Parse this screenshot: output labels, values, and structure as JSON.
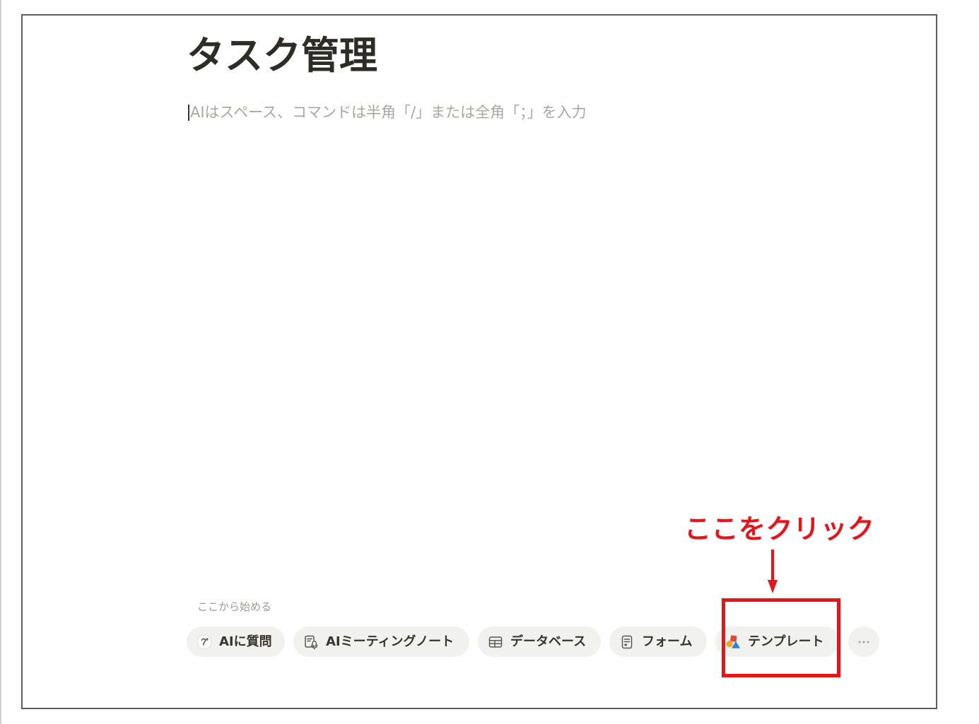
{
  "page": {
    "title": "タスク管理",
    "placeholder": "AIはスペース、コマンドは半角「/」または全角「；」を入力"
  },
  "start_section": {
    "label": "ここから始める",
    "buttons": [
      {
        "label": "AIに質問",
        "icon": "ai-face-icon"
      },
      {
        "label": "AIミーティングノート",
        "icon": "meeting-notes-icon"
      },
      {
        "label": "データベース",
        "icon": "database-table-icon"
      },
      {
        "label": "フォーム",
        "icon": "form-icon"
      },
      {
        "label": "テンプレート",
        "icon": "templates-icon"
      }
    ],
    "more_icon": "more-horizontal-icon"
  },
  "annotation": {
    "text": "ここをクリック",
    "arrow_icon": "arrow-down-icon"
  },
  "colors": {
    "annotation": "#e8141c",
    "chip_background": "#f1f1ef",
    "text": "#37352f",
    "title_text": "#2d2c29",
    "muted_text": "#9b9a97",
    "placeholder_text": "#a8a7a3",
    "frame_border": "#5e5e5e",
    "template_icon_red": "#e5453b",
    "template_icon_orange": "#f4a62a",
    "template_icon_blue": "#2f7fe8"
  }
}
